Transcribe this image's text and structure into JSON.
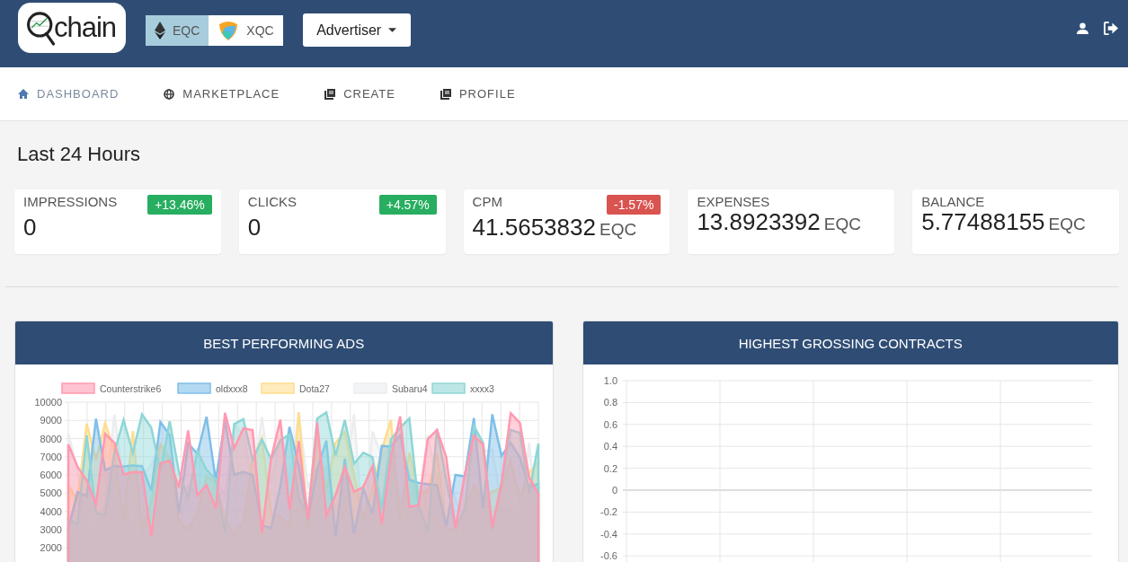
{
  "header": {
    "logo_text": "chain",
    "currencies": [
      {
        "label": "EQC",
        "selected": true
      },
      {
        "label": "XQC",
        "selected": false
      }
    ],
    "role_dropdown": "Advertiser"
  },
  "nav": [
    {
      "label": "DASHBOARD",
      "selected": true
    },
    {
      "label": "MARKETPLACE",
      "selected": false
    },
    {
      "label": "CREATE",
      "selected": false
    },
    {
      "label": "PROFILE",
      "selected": false
    }
  ],
  "section_title": "Last 24 Hours",
  "stats": [
    {
      "label": "IMPRESSIONS",
      "value": "0",
      "badge": {
        "text": "+13.46%",
        "color": "#27ae60"
      }
    },
    {
      "label": "CLICKS",
      "value": "0",
      "badge": {
        "text": "+4.57%",
        "color": "#27ae60"
      }
    },
    {
      "label": "CPM",
      "value": "41.5653832",
      "unit": "EQC",
      "badge": {
        "text": "-1.57%",
        "color": "#d9534f"
      }
    },
    {
      "label": "EXPENSES",
      "value": "13.8923392",
      "unit": "EQC"
    },
    {
      "label": "BALANCE",
      "value": "5.77488155",
      "unit": "EQC"
    }
  ],
  "panels": [
    {
      "title": "BEST PERFORMING ADS",
      "legend": [
        {
          "label": "Counterstrike6",
          "color": "#ff99b0"
        },
        {
          "label": "oldxxx8",
          "color": "#7fbfe8"
        },
        {
          "label": "Dota27",
          "color": "#ffdd8f"
        },
        {
          "label": "Subaru4",
          "color": "#ebedf0"
        },
        {
          "label": "xxxx3",
          "color": "#8fd6d6"
        }
      ],
      "y_axis_labels": [
        "10000",
        "9000",
        "8000",
        "7000",
        "6000",
        "5000",
        "4000",
        "3000",
        "2000"
      ]
    },
    {
      "title": "HIGHEST GROSSING CONTRACTS",
      "y_axis_labels": [
        "1.0",
        "0.8",
        "0.6",
        "0.4",
        "0.2",
        "0",
        "-0.2",
        "-0.4",
        "-0.6"
      ]
    }
  ]
}
